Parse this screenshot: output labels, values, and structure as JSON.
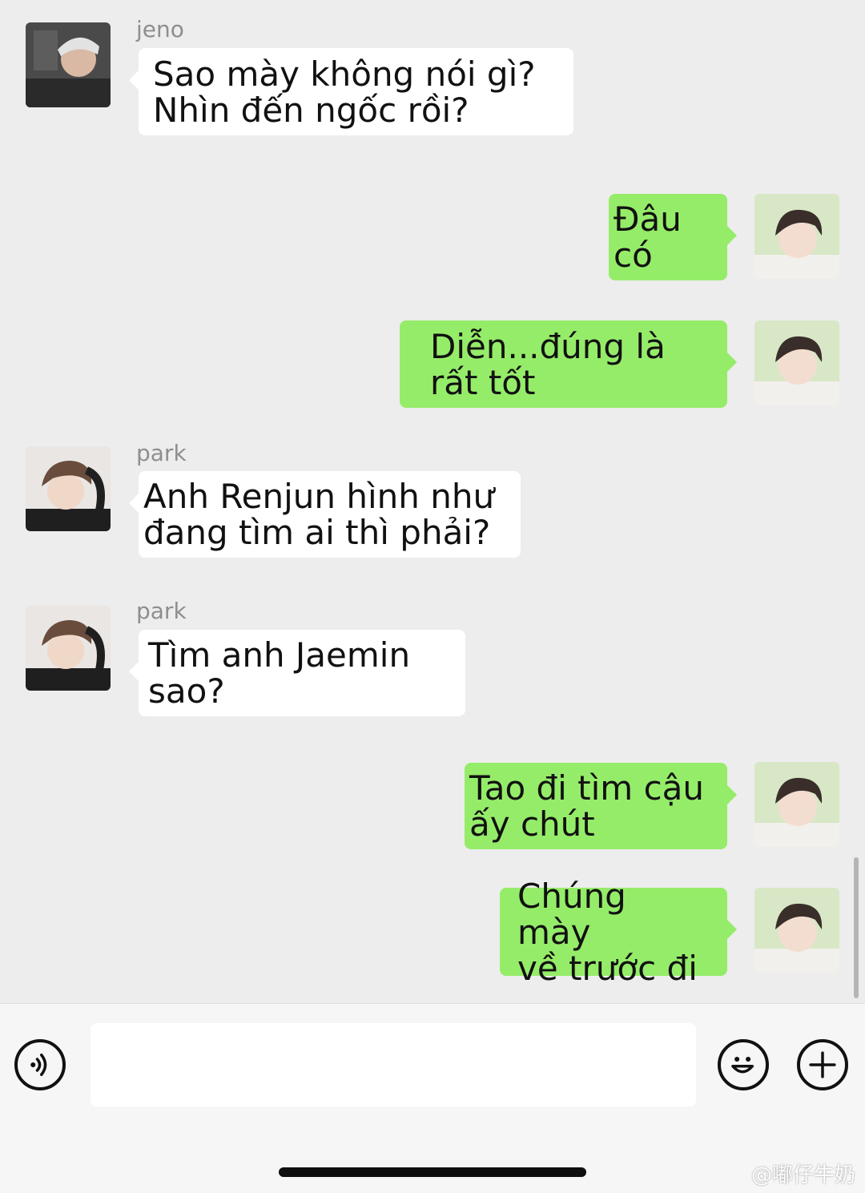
{
  "messages": [
    {
      "sender": "jeno",
      "direction": "incoming",
      "text": "Sao mày không nói gì?\nNhìn đến ngốc rồi?",
      "avatar": "jeno-avatar"
    },
    {
      "direction": "outgoing",
      "text": "Đâu có",
      "avatar": "self-avatar"
    },
    {
      "direction": "outgoing",
      "text": "Diễn...đúng là\nrất tốt",
      "avatar": "self-avatar"
    },
    {
      "sender": "park",
      "direction": "incoming",
      "text": "Anh Renjun hình như\nđang tìm ai thì phải?",
      "avatar": "park-avatar"
    },
    {
      "sender": "park",
      "direction": "incoming",
      "text": "Tìm anh Jaemin sao?",
      "avatar": "park-avatar"
    },
    {
      "direction": "outgoing",
      "text": "Tao đi tìm cậu\nấy chút",
      "avatar": "self-avatar"
    },
    {
      "direction": "outgoing",
      "text": "Chúng mày\nvề trước đi",
      "avatar": "self-avatar"
    }
  ],
  "input_bar": {
    "voice_icon": "voice-icon",
    "message_value": "",
    "emoji_icon": "emoji-icon",
    "add_icon": "plus-icon"
  },
  "watermark": {
    "credit": "@嘟仔牛奶"
  },
  "colors": {
    "background": "#ededed",
    "outgoing_bubble": "#95ec69",
    "incoming_bubble": "#ffffff"
  }
}
